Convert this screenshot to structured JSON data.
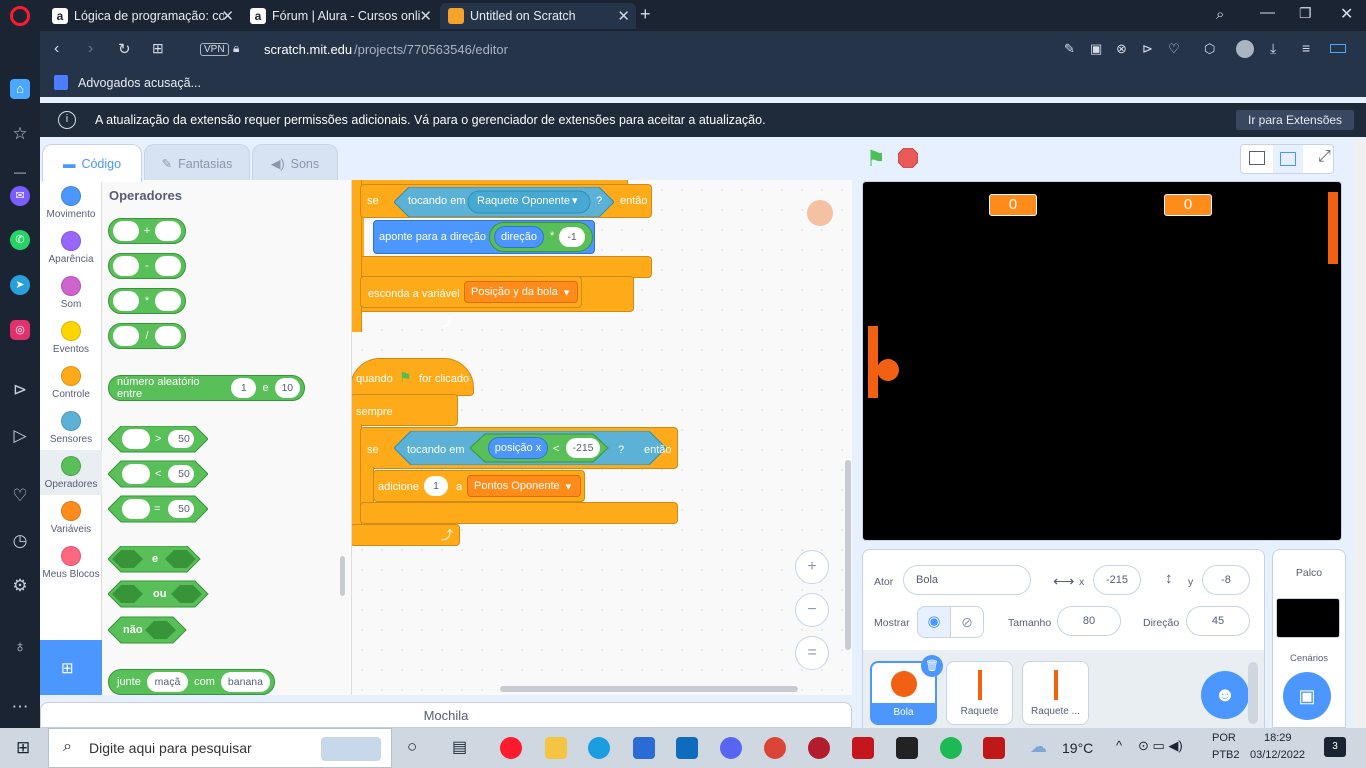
{
  "browser": {
    "tabs": [
      {
        "label": "Lógica de programação: co",
        "active": false
      },
      {
        "label": "Fórum | Alura - Cursos onli",
        "active": false
      },
      {
        "label": "Untitled on Scratch",
        "active": true
      }
    ],
    "new_tab": "+",
    "vpn": "VPN",
    "url_host": "scratch.mit.edu",
    "url_path": "/projects/770563546/editor",
    "bookmark": "Advogados acusaçã...",
    "info_message": "A atualização da extensão requer permissões adicionais. Vá para o gerenciador de extensões para aceitar a atualização.",
    "info_button": "Ir para Extensões"
  },
  "scratch": {
    "tabs": {
      "code": "Código",
      "costumes": "Fantasias",
      "sounds": "Sons"
    },
    "categories": [
      {
        "label": "Movimento",
        "color": "#4c97ff"
      },
      {
        "label": "Aparência",
        "color": "#9966ff"
      },
      {
        "label": "Som",
        "color": "#cf63cf"
      },
      {
        "label": "Eventos",
        "color": "#ffd500"
      },
      {
        "label": "Controle",
        "color": "#ffab19"
      },
      {
        "label": "Sensores",
        "color": "#5cb1d6"
      },
      {
        "label": "Operadores",
        "color": "#59c059"
      },
      {
        "label": "Variáveis",
        "color": "#ff8c1a"
      },
      {
        "label": "Meus Blocos",
        "color": "#ff6680"
      }
    ],
    "palette": {
      "title": "Operadores",
      "ops": [
        "+",
        "-",
        "*",
        "/"
      ],
      "random": {
        "label": "número aleatório entre",
        "from": "1",
        "and": "e",
        "to": "10"
      },
      "compare": [
        {
          "op": ">",
          "val": "50"
        },
        {
          "op": "<",
          "val": "50"
        },
        {
          "op": "=",
          "val": "50"
        }
      ],
      "and": "e",
      "or": "ou",
      "not": "não",
      "join": {
        "label": "junte",
        "a": "maçã",
        "with": "com",
        "b": "banana"
      }
    },
    "script1": {
      "if": "se",
      "touching": "tocando em",
      "touch_target": "Raquete Oponente",
      "q": "?",
      "then": "então",
      "point": "aponte para a direção",
      "dir_var": "direção",
      "times": "*",
      "neg": "-1",
      "hide_var": "esconda a variável",
      "hide_var_name": "Posição y da bola"
    },
    "script2": {
      "when": "quando",
      "clicked": "for clicado",
      "forever": "sempre",
      "if": "se",
      "touching": "tocando em",
      "pos_x": "posição x",
      "lt": "<",
      "val": "-215",
      "q": "?",
      "then": "então",
      "add": "adicione",
      "add_val": "1",
      "a": "a",
      "var_name": "Pontos Oponente"
    },
    "zoom": {
      "in": "+",
      "out": "−",
      "reset": "="
    },
    "backpack": "Mochila",
    "stage": {
      "score_left": "0",
      "score_right": "0"
    },
    "sprite_info": {
      "sprite_label": "Ator",
      "sprite_name": "Bola",
      "x_label": "x",
      "x": "-215",
      "y_label": "y",
      "y": "-8",
      "show_label": "Mostrar",
      "size_label": "Tamanho",
      "size": "80",
      "dir_label": "Direção",
      "dir": "45"
    },
    "sprites": [
      {
        "name": "Bola",
        "selected": true
      },
      {
        "name": "Raquete",
        "selected": false
      },
      {
        "name": "Raquete ...",
        "selected": false
      }
    ],
    "stage_panel": {
      "title": "Palco",
      "backdrops": "Cenários"
    }
  },
  "taskbar": {
    "search_placeholder": "Digite aqui para pesquisar",
    "weather": "19°C",
    "lang1": "POR",
    "lang2": "PTB2",
    "time": "18:29",
    "date": "03/12/2022",
    "notifications": "3"
  }
}
